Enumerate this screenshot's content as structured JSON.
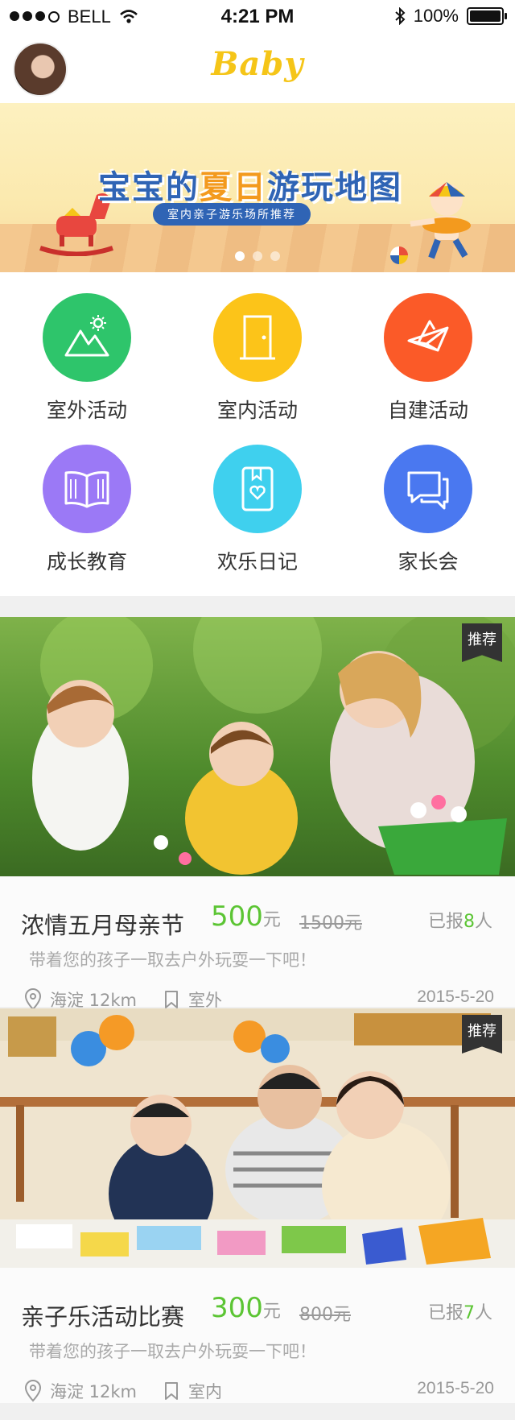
{
  "status_bar": {
    "carrier": "BELL",
    "time": "4:21 PM",
    "battery": "100%"
  },
  "header": {
    "logo": "Baby"
  },
  "banner": {
    "title_part1": "宝宝的",
    "title_highlight": "夏日",
    "title_part2": "游玩地图",
    "subtitle": "室内亲子游乐场所推荐",
    "page_count": 3,
    "active_page": 1
  },
  "categories": [
    {
      "label": "室外活动",
      "color": "#2ec56b",
      "icon": "mountain-sun-icon"
    },
    {
      "label": "室内活动",
      "color": "#fcc419",
      "icon": "door-icon"
    },
    {
      "label": "自建活动",
      "color": "#fb5a28",
      "icon": "origami-swan-icon"
    },
    {
      "label": "成长教育",
      "color": "#9b79f6",
      "icon": "open-book-icon"
    },
    {
      "label": "欢乐日记",
      "color": "#3fd0ee",
      "icon": "diary-heart-icon"
    },
    {
      "label": "家长会",
      "color": "#4a78f0",
      "icon": "chat-bubbles-icon"
    }
  ],
  "activities": [
    {
      "tag": "推荐",
      "title": "浓情五月母亲节",
      "price": "500",
      "price_unit": "元",
      "original_price": "1500元",
      "joined_prefix": "已报",
      "joined_count": "8",
      "joined_suffix": "人",
      "description": "带着您的孩子一取去户外玩耍一下吧！",
      "location": "海淀 12km",
      "type": "室外",
      "date": "2015-5-20"
    },
    {
      "tag": "推荐",
      "title": "亲子乐活动比赛",
      "price": "300",
      "price_unit": "元",
      "original_price": "800元",
      "joined_prefix": "已报",
      "joined_count": "7",
      "joined_suffix": "人",
      "description": "带着您的孩子一取去户外玩耍一下吧！",
      "location": "海淀 12km",
      "type": "室内",
      "date": "2015-5-20"
    }
  ],
  "colors": {
    "accent_green": "#5cc534",
    "logo_yellow": "#f5c518"
  }
}
